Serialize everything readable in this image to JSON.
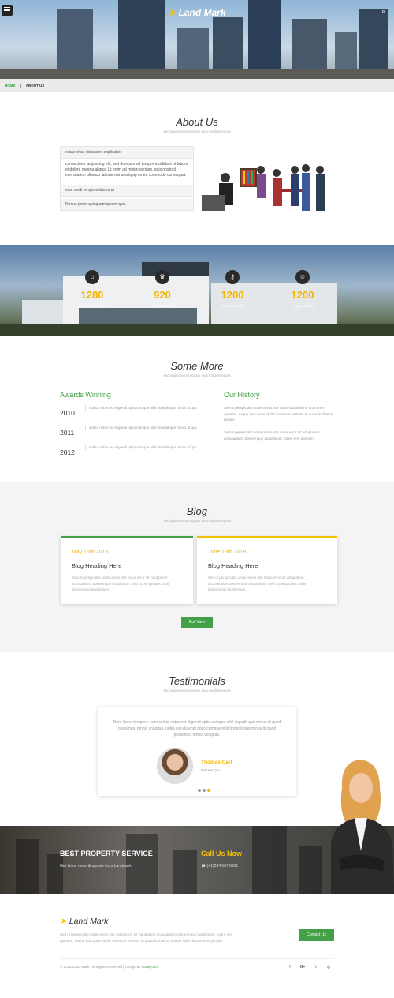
{
  "header": {
    "logo": "Land Mark"
  },
  "breadcrumb": {
    "home": "HOME",
    "sep": "|",
    "current": "ABOUT US"
  },
  "about": {
    "title": "About Us",
    "subtitle": "sed quia non numquam eius modi tempora",
    "acc1": "eatae vitae dicta sunt explicabo",
    "acc1_body": "consectetur adipiscing elit, sed do eiusmod tempor incididunt ut labore et dolore magna aliqua. Ut enim ad minim veniam, quis nostrud exercitation ullamco laboris nisi ut aliquip ex ea commodo consequat.",
    "acc2": "eius modi tempora labore et",
    "acc3": "Neque porro quisquam ipsum quia"
  },
  "stats": [
    {
      "icon": "home-icon",
      "glyph": "⌂",
      "value": "1280",
      "label": "Complete Project"
    },
    {
      "icon": "trophy-icon",
      "glyph": "♛",
      "value": "920",
      "label": "Awards Win"
    },
    {
      "icon": "key-icon",
      "glyph": "⚷",
      "value": "1200",
      "label": "Property Sold"
    },
    {
      "icon": "smile-icon",
      "glyph": "☺",
      "value": "1200",
      "label": "Happy Clients"
    }
  ],
  "more": {
    "title": "Some More",
    "subtitle": "sed quia non numquam eius modi tempora",
    "awards_title": "Awards Winning",
    "awards": [
      {
        "year": "2010",
        "text": "soluta nobis est eligendi optio cumque nihil impedit quo minus id quo"
      },
      {
        "year": "2011",
        "text": "soluta nobis est eligendi optio cumque nihil impedit quo minus id quo"
      },
      {
        "year": "2012",
        "text": "soluta nobis est eligendi optio cumque nihil impedit quo minus id quo"
      }
    ],
    "history_title": "Our History",
    "history_p1": "Sed ut perspiciatis unde omnis iste natus laudantium, totam rem aperiam, eaque ipsa quae ab illo inventore veritatis et quasi architecto beatae",
    "history_p2": "Sed ut perspiciatis unde omnis iste natus error sit voluptatem accusantium doloremque laudantium, totam rem aperiam"
  },
  "blog": {
    "title": "Blog",
    "subtitle": "sed quia non numquam eius modi tempora",
    "cards": [
      {
        "date": "May 15th 2018",
        "heading": "Blog Heading Here",
        "text": "Sed ut perspiciatis unde omnis iste natus error sit voluptatem accusantium doloremque laudantium. Sed ut perspiciatis unde doloremque laudantium."
      },
      {
        "date": "June 13th 2018",
        "heading": "Blog Heading Here",
        "text": "Sed ut perspiciatis unde omnis iste natus error sit voluptatem accusantium doloremque laudantium. Sed ut perspiciatis unde doloremque laudantium."
      }
    ],
    "button": "Full View"
  },
  "testimonials": {
    "title": "Testimonials",
    "subtitle": "sed quia non numquam eius modi tempora",
    "quote": "Nam libero tempore, cum soluta nobis est eligendi optio cumque nihil impedit quo minus id quod possimus, omnis voluptas. nobis est eligendi optio cumque nihil impedit quo minus id quod possimus, omnis voluptas.",
    "name": "Thomas Carl",
    "role": "Placeat Quo"
  },
  "banner": {
    "service_title": "BEST PROPERTY SERVICE",
    "service_sub": "Get latest news & update from Landmark",
    "call_title": "Call Us Now",
    "phone": "(+1)234 567 8901"
  },
  "footer": {
    "logo": "Land Mark",
    "text": "Sed ut perspiciatis unde omnis iste natus error sit voluptatem accusantium doloremque laudantium, totam rem aperiam, eaque ipsa quae ab illo inventore veritatis et quasi architecto beatae vitae dicta sunt explicabo.",
    "contact_button": "Contact Us",
    "copyright": "© 2018 Land Mark. All Rights Reserved | Design by",
    "designer": "W3layouts",
    "social": [
      "f",
      "G+",
      "t",
      "◎"
    ]
  },
  "colors": {
    "accent_green": "#43a047",
    "accent_yellow": "#f2b600"
  }
}
